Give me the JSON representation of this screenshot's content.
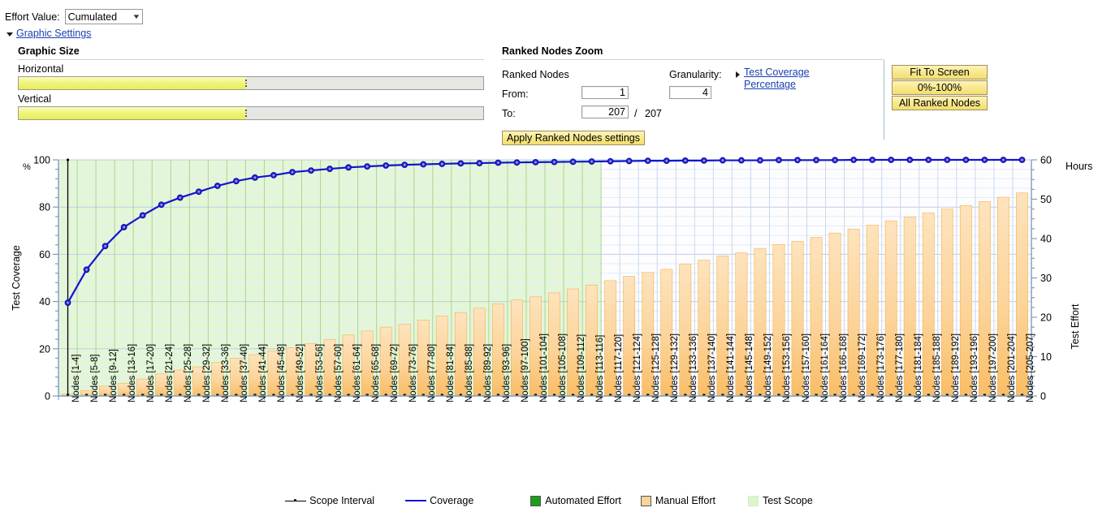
{
  "toolbar": {
    "effort_value_label": "Effort Value:",
    "effort_value_selected": "Cumulated",
    "effort_value_options": [
      "Cumulated"
    ],
    "graphic_settings_link": "Graphic Settings"
  },
  "graphic_size": {
    "title": "Graphic Size",
    "horizontal_label": "Horizontal",
    "vertical_label": "Vertical",
    "horizontal_percent": 49,
    "vertical_percent": 49
  },
  "ranked_nodes_zoom": {
    "title": "Ranked Nodes Zoom",
    "ranked_nodes_label": "Ranked Nodes",
    "from_label": "From:",
    "from_value": "1",
    "to_label": "To:",
    "to_value": "207",
    "to_separator": "/",
    "to_total": "207",
    "granularity_label": "Granularity:",
    "granularity_value": "4",
    "test_coverage_link": "Test Coverage Percentage",
    "apply_button": "Apply Ranked Nodes settings",
    "fit_to_screen_button": "Fit To Screen",
    "percent_range_button": "0%-100%",
    "all_ranked_nodes_button": "All Ranked Nodes"
  },
  "chart_data": {
    "type": "line",
    "title": "",
    "xlabel": "",
    "ylabel": "Test Coverage",
    "y_unit": "%",
    "ylim": [
      0,
      100
    ],
    "yticks": [
      0,
      20,
      40,
      60,
      80,
      100
    ],
    "y2label": "Test Effort",
    "y2_unit": "Hours",
    "y2lim": [
      0,
      60
    ],
    "y2ticks": [
      0,
      10,
      20,
      30,
      40,
      50,
      60
    ],
    "grid": true,
    "legend_position": "bottom",
    "scope_interval_x_index": 0,
    "test_scope_end_index": 29,
    "categories": [
      "Nodes [1-4]",
      "Nodes [5-8]",
      "Nodes [9-12]",
      "Nodes [13-16]",
      "Nodes [17-20]",
      "Nodes [21-24]",
      "Nodes [25-28]",
      "Nodes [29-32]",
      "Nodes [33-36]",
      "Nodes [37-40]",
      "Nodes [41-44]",
      "Nodes [45-48]",
      "Nodes [49-52]",
      "Nodes [53-56]",
      "Nodes [57-60]",
      "Nodes [61-64]",
      "Nodes [65-68]",
      "Nodes [69-72]",
      "Nodes [73-76]",
      "Nodes [77-80]",
      "Nodes [81-84]",
      "Nodes [85-88]",
      "Nodes [89-92]",
      "Nodes [93-96]",
      "Nodes [97-100]",
      "Nodes [101-104]",
      "Nodes [105-108]",
      "Nodes [109-112]",
      "Nodes [113-116]",
      "Nodes [117-120]",
      "Nodes [121-124]",
      "Nodes [125-128]",
      "Nodes [129-132]",
      "Nodes [133-136]",
      "Nodes [137-140]",
      "Nodes [141-144]",
      "Nodes [145-148]",
      "Nodes [149-152]",
      "Nodes [153-156]",
      "Nodes [157-160]",
      "Nodes [161-164]",
      "Nodes [166-168]",
      "Nodes [169-172]",
      "Nodes [173-176]",
      "Nodes [177-180]",
      "Nodes [181-184]",
      "Nodes [185-188]",
      "Nodes [189-192]",
      "Nodes [193-196]",
      "Nodes [197-200]",
      "Nodes [201-204]",
      "Nodes [205-207]"
    ],
    "series": [
      {
        "name": "Coverage",
        "type": "line",
        "axis": "left",
        "unit": "%",
        "color": "#1414d2",
        "values": [
          39.5,
          53.5,
          63.5,
          71.5,
          76.5,
          81.0,
          84.0,
          86.5,
          89.0,
          91.0,
          92.5,
          93.5,
          94.8,
          95.5,
          96.2,
          96.8,
          97.2,
          97.6,
          97.9,
          98.1,
          98.3,
          98.5,
          98.6,
          98.8,
          98.9,
          99.0,
          99.1,
          99.2,
          99.3,
          99.4,
          99.5,
          99.6,
          99.6,
          99.7,
          99.7,
          99.8,
          99.8,
          99.8,
          99.9,
          99.9,
          99.9,
          99.9,
          100.0,
          100.0,
          100.0,
          100.0,
          100.0,
          100.0,
          100.0,
          100.0,
          100.0,
          100.0
        ]
      },
      {
        "name": "Manual Effort",
        "type": "bar",
        "axis": "right",
        "unit": "Hours",
        "color": "#fac97a",
        "values": [
          0.5,
          1.4,
          2.5,
          3.2,
          4.3,
          5.6,
          6.6,
          7.4,
          8.5,
          9.6,
          10.5,
          11.5,
          12.3,
          13.3,
          14.3,
          15.5,
          16.5,
          17.5,
          18.2,
          19.3,
          20.3,
          21.2,
          22.3,
          23.4,
          24.4,
          25.2,
          26.2,
          27.2,
          28.2,
          29.3,
          30.4,
          31.4,
          32.2,
          33.5,
          34.5,
          35.6,
          36.4,
          37.5,
          38.5,
          39.3,
          40.3,
          41.4,
          42.4,
          43.4,
          44.5,
          45.5,
          46.5,
          47.5,
          48.4,
          49.4,
          50.5,
          51.6
        ]
      },
      {
        "name": "Automated Effort",
        "type": "bar",
        "axis": "right",
        "unit": "Hours",
        "color": "#1c9e1c",
        "values": [
          0.15,
          0.15,
          0.15,
          0.15,
          0.15,
          0.15,
          0.15,
          0.15,
          0.15,
          0.15,
          0.15,
          0.15,
          0.15,
          0.15,
          0.15,
          0.15,
          0.15,
          0.15,
          0.15,
          0.15,
          0.15,
          0.15,
          0.15,
          0.15,
          0.15,
          0.15,
          0.15,
          0.15,
          0.15,
          0.15,
          0.15,
          0.15,
          0.15,
          0.15,
          0.15,
          0.15,
          0.15,
          0.15,
          0.15,
          0.15,
          0.15,
          0.15,
          0.15,
          0.15,
          0.15,
          0.15,
          0.15,
          0.15,
          0.15,
          0.15,
          0.15,
          0.15
        ]
      }
    ],
    "legend": [
      {
        "label": "Scope Interval",
        "kind": "line-marker",
        "color": "#000000"
      },
      {
        "label": "Coverage",
        "kind": "line",
        "color": "#1414d2"
      },
      {
        "label": "Automated Effort",
        "kind": "swatch",
        "color": "#1c9e1c"
      },
      {
        "label": "Manual Effort",
        "kind": "swatch",
        "color": "#fbd29a"
      },
      {
        "label": "Test Scope",
        "kind": "swatch",
        "color": "#ddf5cf"
      }
    ]
  }
}
